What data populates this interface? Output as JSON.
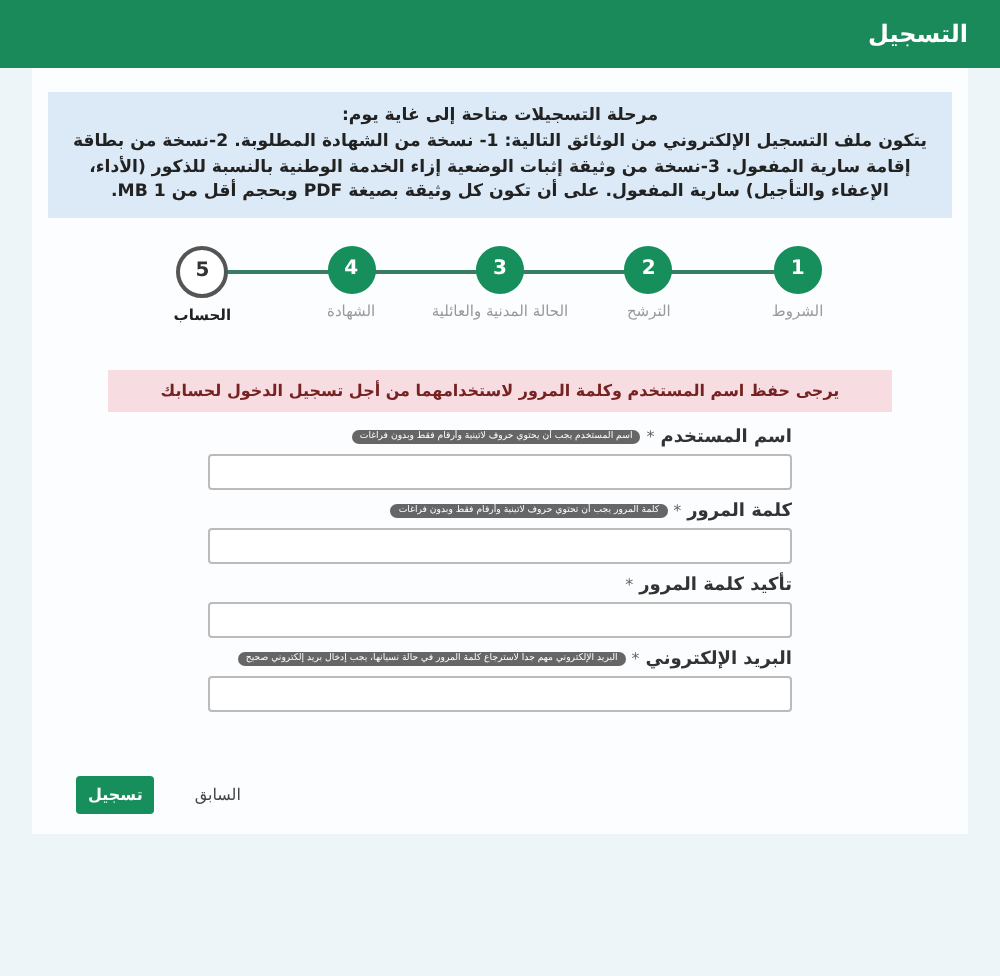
{
  "header": {
    "title": "التسجيل"
  },
  "notice": {
    "title": "مرحلة التسجيلات متاحة إلى غاية يوم:",
    "body": "يتكون ملف التسجيل الإلكتروني من الوثائق التالية: 1- نسخة من الشهادة المطلوبة. 2-نسخة من بطاقة إقامة سارية المفعول. 3-نسخة من وثيقة إثبات الوضعية إزاء الخدمة الوطنية بالنسبة للذكور (الأداء، الإعفاء والتأجيل) سارية المفعول. على أن تكون كل وثيقة بصيغة PDF وبحجم أقل من 1 MB."
  },
  "steps": [
    {
      "number": "1",
      "label": "الشروط",
      "done": true,
      "selected": false
    },
    {
      "number": "2",
      "label": "الترشح",
      "done": true,
      "selected": false
    },
    {
      "number": "3",
      "label": "الحالة المدنية والعائلية",
      "done": true,
      "selected": false
    },
    {
      "number": "4",
      "label": "الشهادة",
      "done": true,
      "selected": false
    },
    {
      "number": "5",
      "label": "الحساب",
      "done": false,
      "selected": true
    }
  ],
  "alert": {
    "text": "يرجى حفظ اسم المستخدم وكلمة المرور لاستخدامهما من أجل تسجيل الدخول لحسابك"
  },
  "fields": [
    {
      "label": "اسم المستخدم",
      "required_mark": "*",
      "hint": "اسم المستخدم يجب أن يحتوي حروف لاتينية وأرقام فقط وبدون فراغات"
    },
    {
      "label": "كلمة المرور",
      "required_mark": "*",
      "hint": "كلمة المرور يجب أن تحتوي حروف لاتينية وأرقام فقط وبدون فراغات"
    },
    {
      "label": "تأكيد كلمة المرور",
      "required_mark": "*"
    },
    {
      "label": "البريد الإلكتروني",
      "required_mark": "*",
      "hint": "البريد الإلكتروني مهم جدا لاسترجاع كلمة المرور في حالة نسيانها، يجب إدخال بريد إلكتروني صحيح"
    }
  ],
  "buttons": [
    {
      "label": "السابق",
      "kind": "link"
    },
    {
      "label": "تسجيل",
      "kind": "primary"
    }
  ]
}
